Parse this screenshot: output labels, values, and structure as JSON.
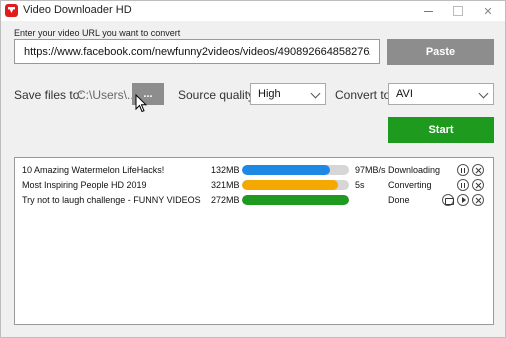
{
  "window": {
    "title": "Video Downloader HD",
    "close_glyph": "✕"
  },
  "url": {
    "caption": "Enter your video URL you want to convert",
    "value": "https://www.facebook.com/newfunny2videos/videos/490892664858276/",
    "paste_label": "Paste"
  },
  "options": {
    "save_label": "Save files to:",
    "save_path": "C:\\Users\\...",
    "browse_label": "...",
    "quality_label": "Source quality",
    "quality_value": "High",
    "convert_label": "Convert to",
    "format_value": "AVI",
    "start_label": "Start"
  },
  "colors": {
    "downloading": "#1e88e5",
    "converting": "#f5a800",
    "done": "#1e9a1e"
  },
  "downloads": [
    {
      "title": "10 Amazing Watermelon LifeHacks!",
      "size": "132MB",
      "progress": 0.82,
      "speed": "97MB/s",
      "status": "Downloading",
      "actions": [
        "pause-icon",
        "close-icon"
      ]
    },
    {
      "title": "Most Inspiring People HD 2019",
      "size": "321MB",
      "progress": 0.9,
      "speed": "5s",
      "status": "Converting",
      "actions": [
        "pause-icon",
        "close-icon"
      ]
    },
    {
      "title": "Try not to laugh challenge -  FUNNY VIDEOS",
      "size": "272MB",
      "progress": 1.0,
      "speed": "",
      "status": "Done",
      "actions": [
        "folder-icon",
        "play-icon",
        "close-icon"
      ]
    }
  ]
}
